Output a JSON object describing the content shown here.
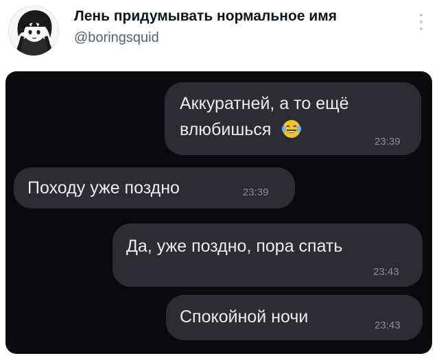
{
  "tweet": {
    "author_name": "Лень придумывать нормальное имя",
    "author_handle": "@boringsquid",
    "icons": {
      "avatar": "anime-girl-avatar",
      "more": "more-options-icon"
    }
  },
  "chat": {
    "messages": [
      {
        "direction": "outgoing",
        "lines": [
          "Аккуратней, а то ещё",
          "влюбишься"
        ],
        "emoji": "face-with-tears-of-joy",
        "time": "23:39"
      },
      {
        "direction": "incoming",
        "lines": [
          "Походу уже поздно"
        ],
        "time": "23:39"
      },
      {
        "direction": "outgoing",
        "lines": [
          "Да, уже поздно, пора спать"
        ],
        "time": "23:43"
      },
      {
        "direction": "outgoing",
        "lines": [
          "Спокойной ночи"
        ],
        "time": "23:43"
      }
    ],
    "colors": {
      "background": "#0a090d",
      "bubble": "#2e2c33",
      "text": "#ececef",
      "time": "#8f8c96"
    }
  }
}
